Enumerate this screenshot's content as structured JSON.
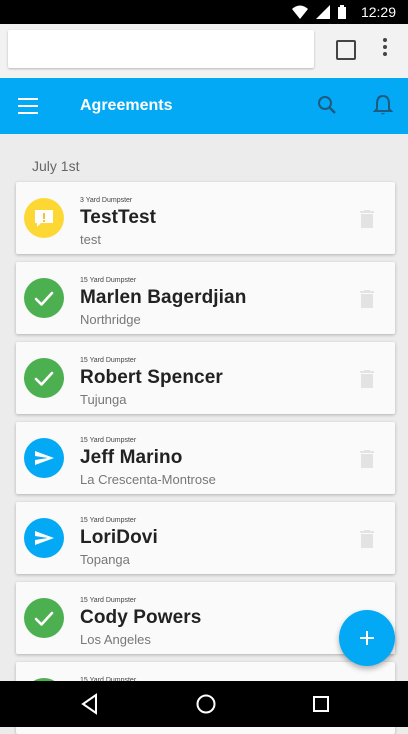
{
  "status_bar": {
    "time": "12:29"
  },
  "browser": {
    "url": ""
  },
  "app_bar": {
    "title": "Agreements"
  },
  "date_header": "July 1st",
  "colors": {
    "primary": "#03a9f4",
    "warning": "#fdd835",
    "success": "#4caf50"
  },
  "agreements": [
    {
      "type": "3 Yard Dumpster",
      "name": "TestTest",
      "location": "test",
      "status": "warning",
      "icon": "alert-message-icon"
    },
    {
      "type": "15 Yard Dumpster",
      "name": "Marlen Bagerdjian",
      "location": "Northridge",
      "status": "success",
      "icon": "check-icon"
    },
    {
      "type": "15 Yard Dumpster",
      "name": "Robert Spencer",
      "location": "Tujunga",
      "status": "success",
      "icon": "check-icon"
    },
    {
      "type": "15 Yard Dumpster",
      "name": "Jeff Marino",
      "location": "La Crescenta-Montrose",
      "status": "primary",
      "icon": "send-icon"
    },
    {
      "type": "15 Yard Dumpster",
      "name": "LoriDovi",
      "location": "Topanga",
      "status": "primary",
      "icon": "send-icon"
    },
    {
      "type": "15 Yard Dumpster",
      "name": "Cody Powers",
      "location": "Los Angeles",
      "status": "success",
      "icon": "check-icon"
    },
    {
      "type": "15 Yard Dumpster",
      "name": "",
      "location": "",
      "status": "success",
      "icon": "check-icon"
    }
  ]
}
